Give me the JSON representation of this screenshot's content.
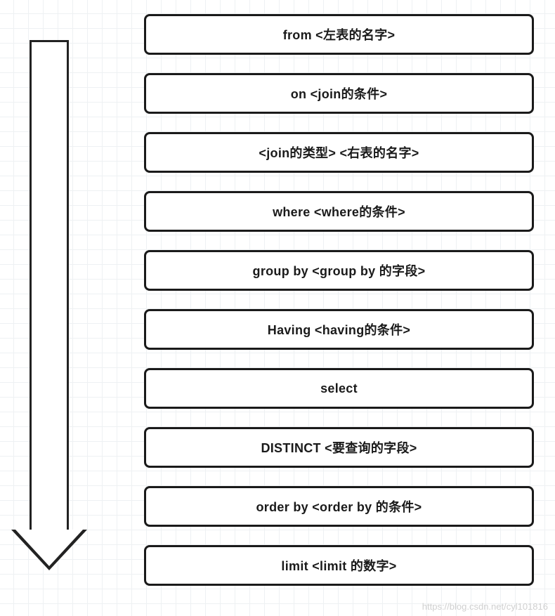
{
  "steps": [
    {
      "label": "from  <左表的名字>"
    },
    {
      "label": "on <join的条件>"
    },
    {
      "label": "<join的类型> <右表的名字>"
    },
    {
      "label": "where <where的条件>"
    },
    {
      "label": "group by <group by 的字段>"
    },
    {
      "label": "Having <having的条件>"
    },
    {
      "label": "select"
    },
    {
      "label": "DISTINCT <要查询的字段>"
    },
    {
      "label": "order by <order by 的条件>"
    },
    {
      "label": "limit <limit 的数字>"
    }
  ],
  "watermark": "https://blog.csdn.net/cyl101816"
}
